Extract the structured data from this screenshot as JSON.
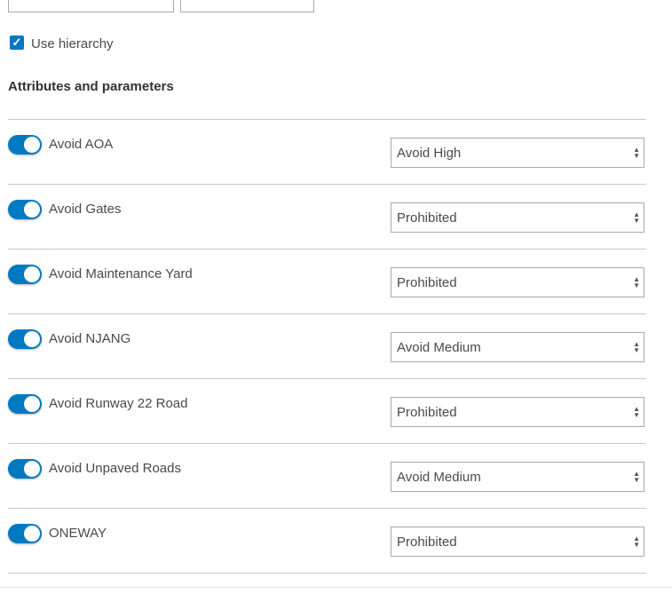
{
  "use_hierarchy": {
    "label": "Use hierarchy",
    "checked": true
  },
  "section_title": "Attributes and parameters",
  "accent": "#0079c1",
  "attributes": [
    {
      "name": "Avoid AOA",
      "enabled": true,
      "value": "Avoid High"
    },
    {
      "name": "Avoid Gates",
      "enabled": true,
      "value": "Prohibited"
    },
    {
      "name": "Avoid Maintenance Yard",
      "enabled": true,
      "value": "Prohibited"
    },
    {
      "name": "Avoid NJANG",
      "enabled": true,
      "value": "Avoid Medium"
    },
    {
      "name": "Avoid Runway 22 Road",
      "enabled": true,
      "value": "Prohibited"
    },
    {
      "name": "Avoid Unpaved Roads",
      "enabled": true,
      "value": "Avoid Medium"
    },
    {
      "name": "ONEWAY",
      "enabled": true,
      "value": "Prohibited"
    }
  ]
}
